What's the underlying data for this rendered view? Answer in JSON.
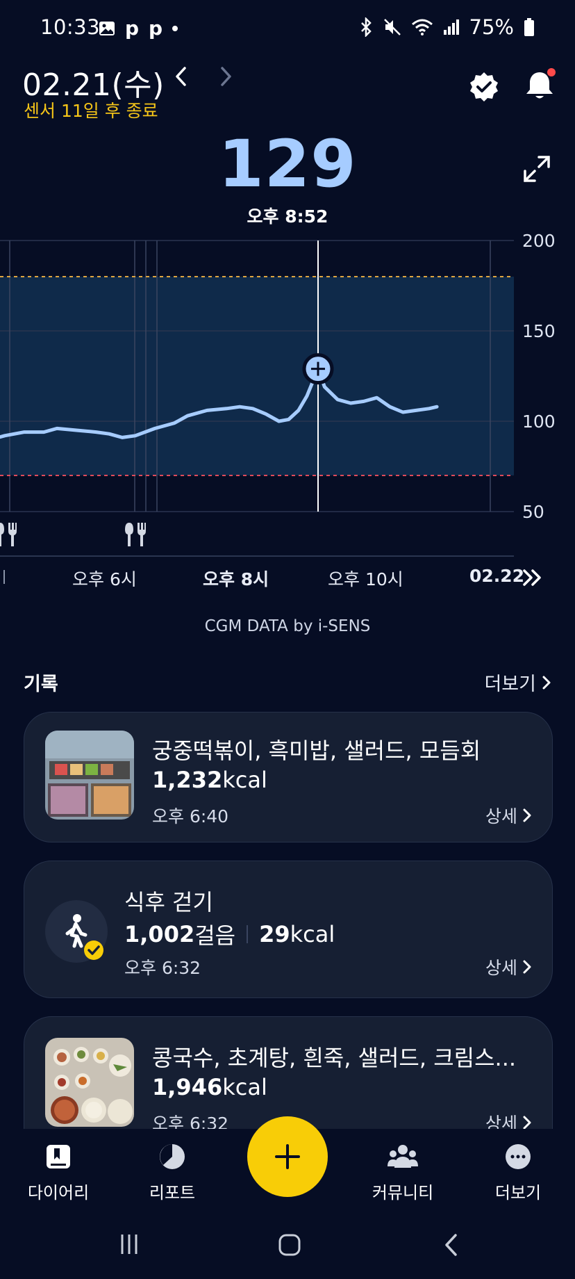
{
  "status_bar": {
    "time": "10:33",
    "battery": "75%",
    "left_icons": [
      "gallery-icon",
      "p-icon",
      "p-icon",
      "dot-icon"
    ],
    "right_icons": [
      "bluetooth-icon",
      "mute-icon",
      "wifi-icon",
      "signal-icon",
      "battery-icon"
    ]
  },
  "header": {
    "date": "02.21(수)",
    "sensor_status": "센서 11일 후 종료",
    "icons": [
      "chevron-left-icon",
      "chevron-right-icon",
      "verified-badge-icon",
      "bell-icon",
      "expand-icon"
    ]
  },
  "glucose": {
    "value": "129",
    "time": "오후 8:52"
  },
  "colors": {
    "background": "#060d24",
    "accent_yellow": "#f8cd07",
    "glucose_blue": "#a6ccff",
    "target_band": "#0f2a4a",
    "high_line": "#e0a640",
    "low_line": "#e04a5a"
  },
  "chart_data": {
    "type": "line",
    "y_ticks": [
      "200",
      "150",
      "100",
      "50"
    ],
    "ylim": [
      50,
      200
    ],
    "target_range": [
      70,
      180
    ],
    "x_ticks": [
      "오후 6시",
      "오후 8시",
      "오후 10시",
      "02.22"
    ],
    "x_unit": "hours since 오후 4시",
    "series": [
      {
        "x": [
          0,
          0.2,
          0.5,
          0.8,
          1.0,
          1.3,
          1.6,
          1.8,
          2.0,
          2.2,
          2.5,
          2.8,
          3.0,
          3.3,
          3.6,
          3.8,
          4.0,
          4.2,
          4.4,
          4.55,
          4.7,
          4.83,
          5.0,
          5.1,
          5.3,
          5.5,
          5.7,
          5.9,
          6.1,
          6.3,
          6.5,
          6.7,
          6.82
        ],
        "values": [
          90,
          92,
          94,
          94,
          96,
          95,
          94,
          93,
          91,
          92,
          96,
          99,
          103,
          106,
          107,
          108,
          107,
          104,
          100,
          101,
          106,
          114,
          129,
          119,
          112,
          110,
          111,
          113,
          108,
          105,
          106,
          107,
          108
        ]
      }
    ],
    "selected_value": "129",
    "meal_markers": [
      "meal-marker-1",
      "meal-marker-2"
    ],
    "credit": "CGM DATA by i-SENS"
  },
  "records": {
    "title": "기록",
    "more_label": "더보기",
    "items": [
      {
        "title": "궁중떡볶이, 흑미밥, 샐러드, 모듬회",
        "kcal_value": "1,232",
        "kcal_unit": "kcal",
        "time": "오후 6:40",
        "detail_label": "상세"
      },
      {
        "title": "식후 걷기",
        "steps_value": "1,002",
        "steps_unit": "걸음",
        "kcal_value": "29",
        "kcal_unit": "kcal",
        "time": "오후 6:32",
        "detail_label": "상세"
      },
      {
        "title": "콩국수, 초계탕, 흰죽, 샐러드, 크림스...",
        "kcal_value": "1,946",
        "kcal_unit": "kcal",
        "time": "오후 6:32",
        "detail_label": "상세"
      }
    ]
  },
  "bottom_nav": {
    "items": [
      {
        "label": "다이어리",
        "icon": "diary-icon"
      },
      {
        "label": "리포트",
        "icon": "report-icon"
      },
      {
        "label": "커뮤니티",
        "icon": "community-icon"
      },
      {
        "label": "더보기",
        "icon": "more-icon"
      }
    ],
    "fab_icon": "plus-icon"
  }
}
